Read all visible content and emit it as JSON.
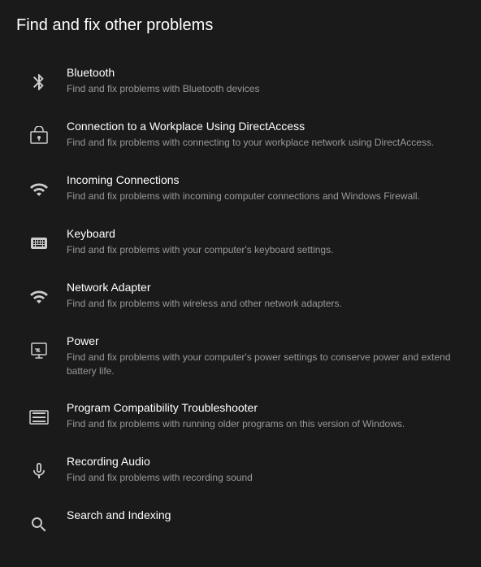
{
  "page": {
    "title": "Find and fix other problems"
  },
  "items": [
    {
      "id": "bluetooth",
      "title": "Bluetooth",
      "description": "Find and fix problems with Bluetooth devices",
      "icon": "bluetooth"
    },
    {
      "id": "directaccess",
      "title": "Connection to a Workplace Using DirectAccess",
      "description": "Find and fix problems with connecting to your workplace network using DirectAccess.",
      "icon": "directaccess"
    },
    {
      "id": "incoming-connections",
      "title": "Incoming Connections",
      "description": "Find and fix problems with incoming computer connections and Windows Firewall.",
      "icon": "incoming"
    },
    {
      "id": "keyboard",
      "title": "Keyboard",
      "description": "Find and fix problems with your computer's keyboard settings.",
      "icon": "keyboard"
    },
    {
      "id": "network-adapter",
      "title": "Network Adapter",
      "description": "Find and fix problems with wireless and other network adapters.",
      "icon": "network"
    },
    {
      "id": "power",
      "title": "Power",
      "description": "Find and fix problems with your computer's power settings to conserve power and extend battery life.",
      "icon": "power"
    },
    {
      "id": "program-compatibility",
      "title": "Program Compatibility Troubleshooter",
      "description": "Find and fix problems with running older programs on this version of Windows.",
      "icon": "program"
    },
    {
      "id": "recording-audio",
      "title": "Recording Audio",
      "description": "Find and fix problems with recording sound",
      "icon": "audio"
    },
    {
      "id": "search-indexing",
      "title": "Search and Indexing",
      "description": "",
      "icon": "search"
    }
  ]
}
